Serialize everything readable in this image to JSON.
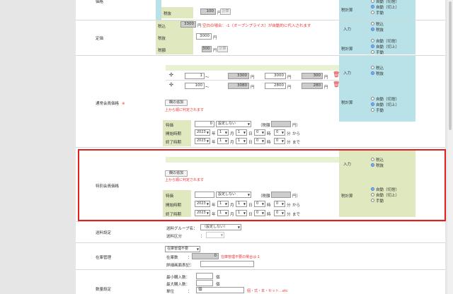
{
  "rows": {
    "top": {
      "label": "価格",
      "zeikomi": "税込",
      "zeikomi_val": "",
      "zeinuki": "税抜",
      "zeinuki_val": "100",
      "yen": "円",
      "calc": "計算",
      "zeikeisan": "税計算"
    },
    "teika": {
      "label": "定価",
      "zeikomi": "税込",
      "zeikomi_val": "3300",
      "yen": "円",
      "note": "空白の場合：-1（オープンプライス）が自動的に代入されます",
      "zeinuki": "税抜",
      "zeinuki_val": "3000",
      "zeigaku": "税額",
      "zeigaku_val": "300",
      "calc": "計算",
      "nyuryoku": "入力",
      "zeikeisan": "税計算"
    },
    "tsujo": {
      "label": "通常会員価格",
      "req": "※",
      "tiers": [
        {
          "min": "1",
          "unit": "〜",
          "p1": "3300",
          "yen": "円",
          "p2": "3000",
          "p3": "300"
        },
        {
          "min": "100",
          "unit": "〜",
          "p1": "3080",
          "yen": "円",
          "p2": "2800",
          "p3": "280"
        }
      ],
      "add_btn": "欄の追加",
      "add_note": "上から順に判定されます",
      "tokka": "特価",
      "tokka_val": "0",
      "tokka_sel": "設定しない",
      "tokka_zei": "（税額",
      "tokka_close": "円）",
      "kaishi": "開始時期",
      "shuryo": "終了時期",
      "year": "2023",
      "nen": "年",
      "month": "1",
      "tsuki": "月",
      "day": "1",
      "hi": "日",
      "hour": "0",
      "ji": "時",
      "minute": "0",
      "fun": "分",
      "kara": "から",
      "made": "まで",
      "nyuryoku": "入力",
      "zeikeisan": "税計算"
    },
    "tokubetsu": {
      "label": "特別会員価格",
      "add_btn": "欄の追加",
      "add_note": "上から順に判定されます",
      "tokka": "特価",
      "tokka_val": "",
      "tokka_sel": "設定しない",
      "tokka_zei": "（税額",
      "tokka_close": "円）",
      "kaishi": "開始時期",
      "shuryo": "終了時期",
      "year": "2023",
      "nen": "年",
      "month": "1",
      "tsuki": "月",
      "day": "1",
      "hi": "日",
      "hour": "0",
      "ji": "時",
      "minute": "0",
      "fun": "分",
      "kara": "から",
      "made": "まで",
      "nyuryoku": "入力",
      "zeikeisan": "税計算"
    },
    "soryo": {
      "label": "送料設定",
      "group_lbl": "送料グループ名：",
      "group_sel": "（設定しない）",
      "kubun_lbl": "送料区分",
      "colon": "："
    },
    "zaiko": {
      "label": "在庫管理",
      "sel": "在庫管理不要",
      "count_lbl": "在庫数",
      "colon": "：",
      "count_val": "0",
      "count_note": "在庫管理不要の場合は-1",
      "detail_lbl": "詳細画面表記："
    },
    "suryo": {
      "label": "数量設定",
      "min_lbl": "最小購入数：",
      "max_lbl": "最大購入数：",
      "tani_lbl": "単位",
      "colon": "：",
      "ko": "個",
      "tani_val": "個",
      "tani_note": "個・式・本・セット…etc"
    }
  },
  "radios": {
    "zeikomi": "税込",
    "zeinuki": "税抜",
    "auto_kirisute": "自動（切捨）",
    "auto_kiriage": "自動（切上）",
    "manual": "手動"
  }
}
